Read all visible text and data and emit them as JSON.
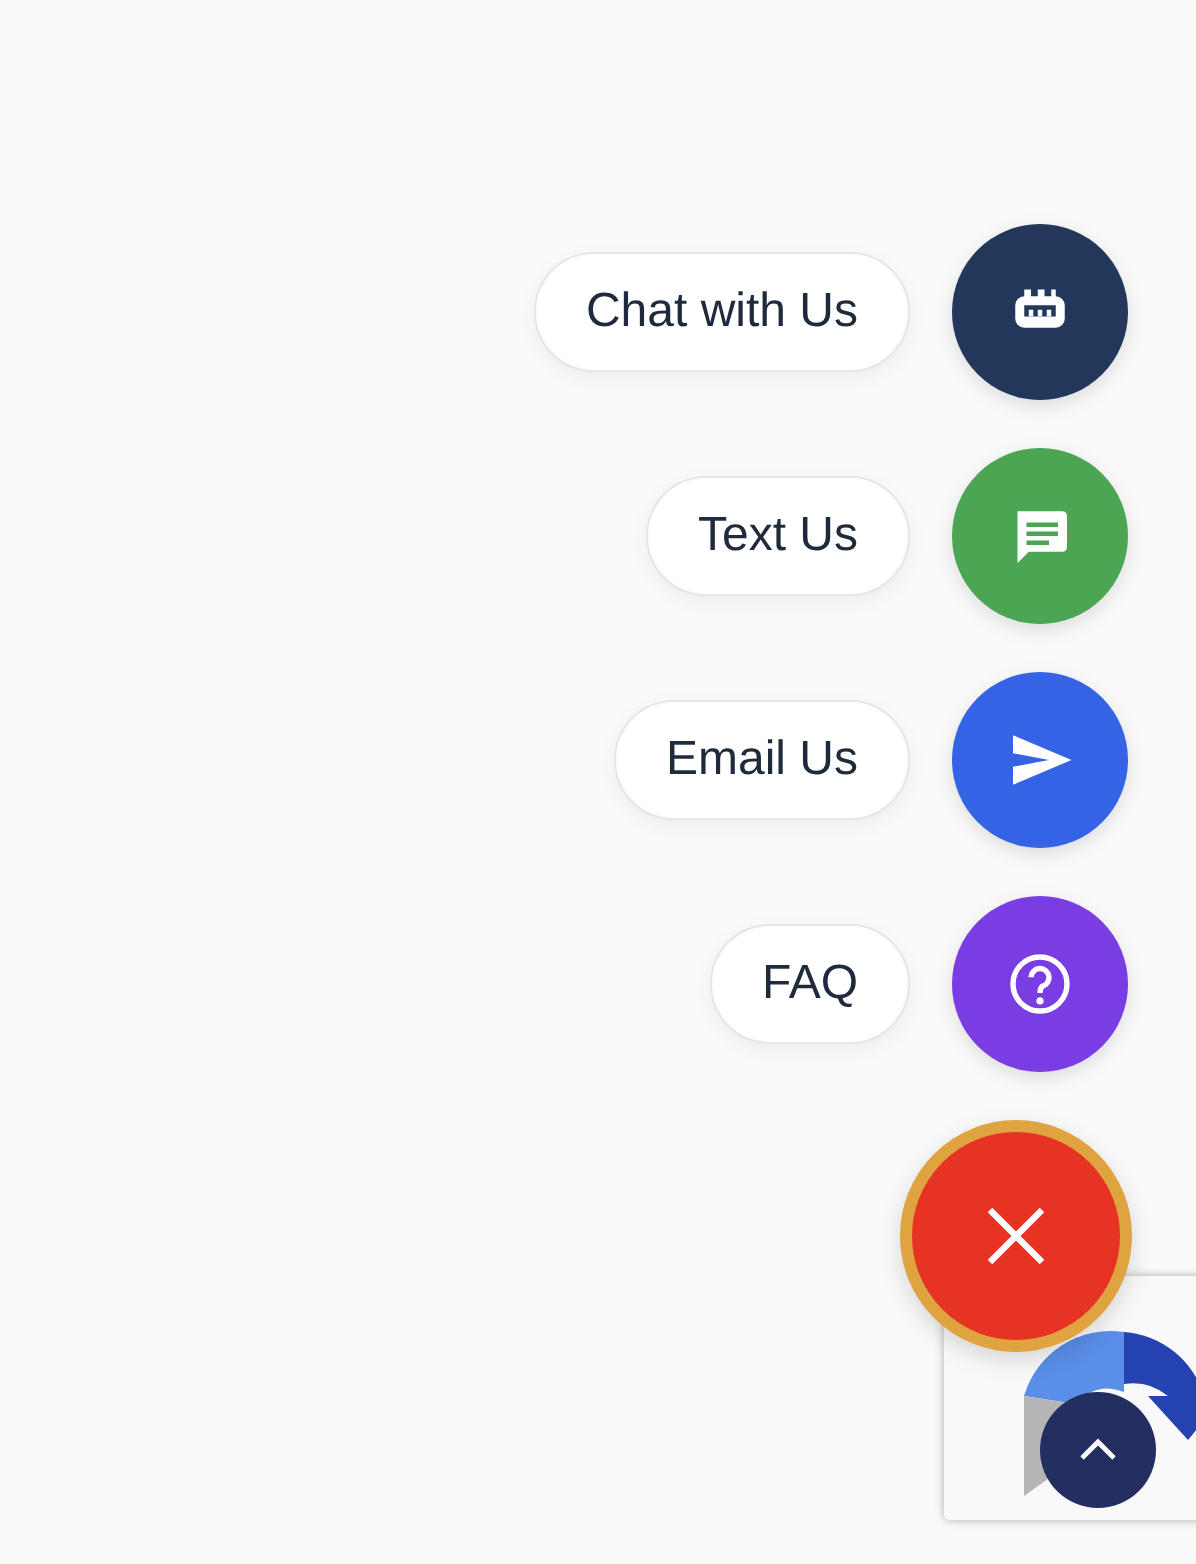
{
  "actions": [
    {
      "label": "Chat with Us",
      "kind": "chat",
      "color": "#22375a"
    },
    {
      "label": "Text Us",
      "kind": "text",
      "color": "#4ca553"
    },
    {
      "label": "Email Us",
      "kind": "email",
      "color": "#3563e6"
    },
    {
      "label": "FAQ",
      "kind": "faq",
      "color": "#7a3de3"
    }
  ],
  "menu_open": true
}
